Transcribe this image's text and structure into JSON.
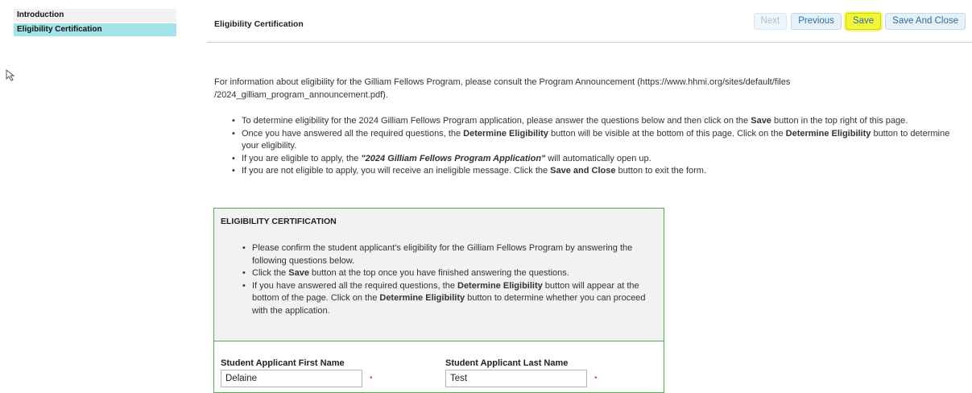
{
  "sidebar": {
    "items": [
      {
        "label": "Introduction"
      },
      {
        "label": "Eligibility Certification"
      }
    ]
  },
  "header": {
    "title": "Eligibility Certification"
  },
  "toolbar": {
    "next_label": "Next",
    "previous_label": "Previous",
    "save_label": "Save",
    "save_close_label": "Save And Close"
  },
  "intro": {
    "line1": "For information about eligibility for the Gilliam Fellows Program, please consult the Program Announcement (https://www.hhmi.org/sites/default/files",
    "line2": "/2024_gilliam_program_announcement.pdf).",
    "b1_pre": "To determine eligibility for the 2024 Gilliam Fellows Program application, please answer the questions below and then click on the ",
    "b1_bold": "Save",
    "b1_post": " button in the top right of this page.",
    "b2_pre": "Once you have answered all the required questions, the ",
    "b2_bold1": "Determine Eligibility",
    "b2_mid": " button will be visible at the bottom of this page. Click on the ",
    "b2_bold2": "Determine Eligibility",
    "b2_post": " button to determine your eligibility.",
    "b3_pre": "If you are eligible to apply, the ",
    "b3_bold": "\"2024 Gilliam Fellows Program Application\"",
    "b3_post": " will automatically open up.",
    "b4_pre": "If you are not eligible to apply, you will receive an ineligible message. Click the ",
    "b4_bold": "Save and Close",
    "b4_post": " button to exit the form."
  },
  "certification": {
    "title": "ELIGIBILITY CERTIFICATION",
    "c1": "Please confirm the student applicant's eligibility for the Gilliam Fellows Program by answering the following questions below.",
    "c2_pre": "Click the ",
    "c2_bold": "Save",
    "c2_post": " button at the top once you have finished answering the questions.",
    "c3_pre": "If you have answered all the required questions, the ",
    "c3_bold1": "Determine Eligibility",
    "c3_mid": " button will appear at the bottom of the page. Click on the ",
    "c3_bold2": "Determine Eligibility",
    "c3_post": " button to determine whether you can proceed with the application."
  },
  "fields": {
    "first_name_label": "Student Applicant First Name",
    "first_name_value": "Delaine",
    "last_name_label": "Student Applicant Last Name",
    "last_name_value": "Test",
    "required_marker": "•"
  },
  "colors": {
    "active_sidebar": "#a3e3ea",
    "highlight": "#f3f53a",
    "box_border": "#4caf50",
    "required": "#d9534f"
  }
}
